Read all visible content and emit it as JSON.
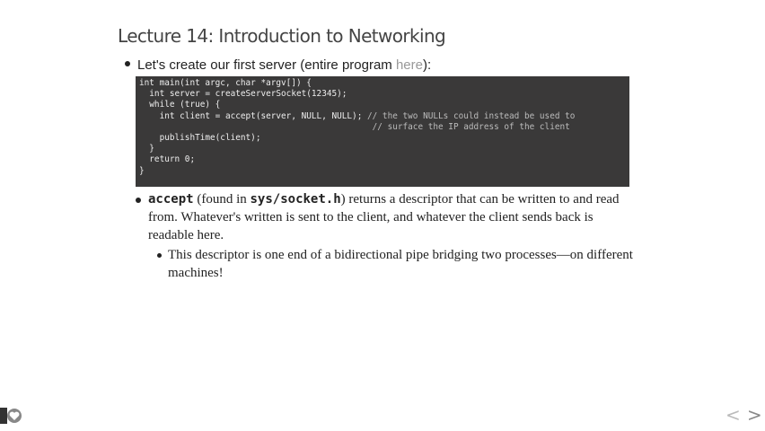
{
  "slide": {
    "title": "Lecture 14: Introduction to Networking",
    "bullet1_text": "Let's create our first server (entire program ",
    "bullet1_link": "here",
    "bullet1_end": "):",
    "code_lines": [
      "int main(int argc, char *argv[]) {",
      "  int server = createServerSocket(12345);",
      "  while (true) {",
      "    int client = accept(server, NULL, NULL);",
      "",
      "    publishTime(client);",
      "  }",
      "  return 0;",
      "}"
    ],
    "code_comment_1": " // the two NULLs could instead be used to",
    "code_comment_2": "// surface the IP address of the client",
    "bullet2_code1": "accept",
    "bullet2_part1": " (found in ",
    "bullet2_code2": "sys/socket.h",
    "bullet2_part2": ") returns a descriptor that can be written to and read from. Whatever's written is sent to the client, and whatever the client sends back is readable here.",
    "bullet3": "This descriptor is one end of a bidirectional pipe bridging two processes—on different machines!"
  },
  "nav": {
    "prev_icon": "chevron-left-icon",
    "next_icon": "chevron-right-icon",
    "prev": "<",
    "next": ">"
  },
  "colors": {
    "code_bg": "#3a3939",
    "link": "#999999"
  }
}
